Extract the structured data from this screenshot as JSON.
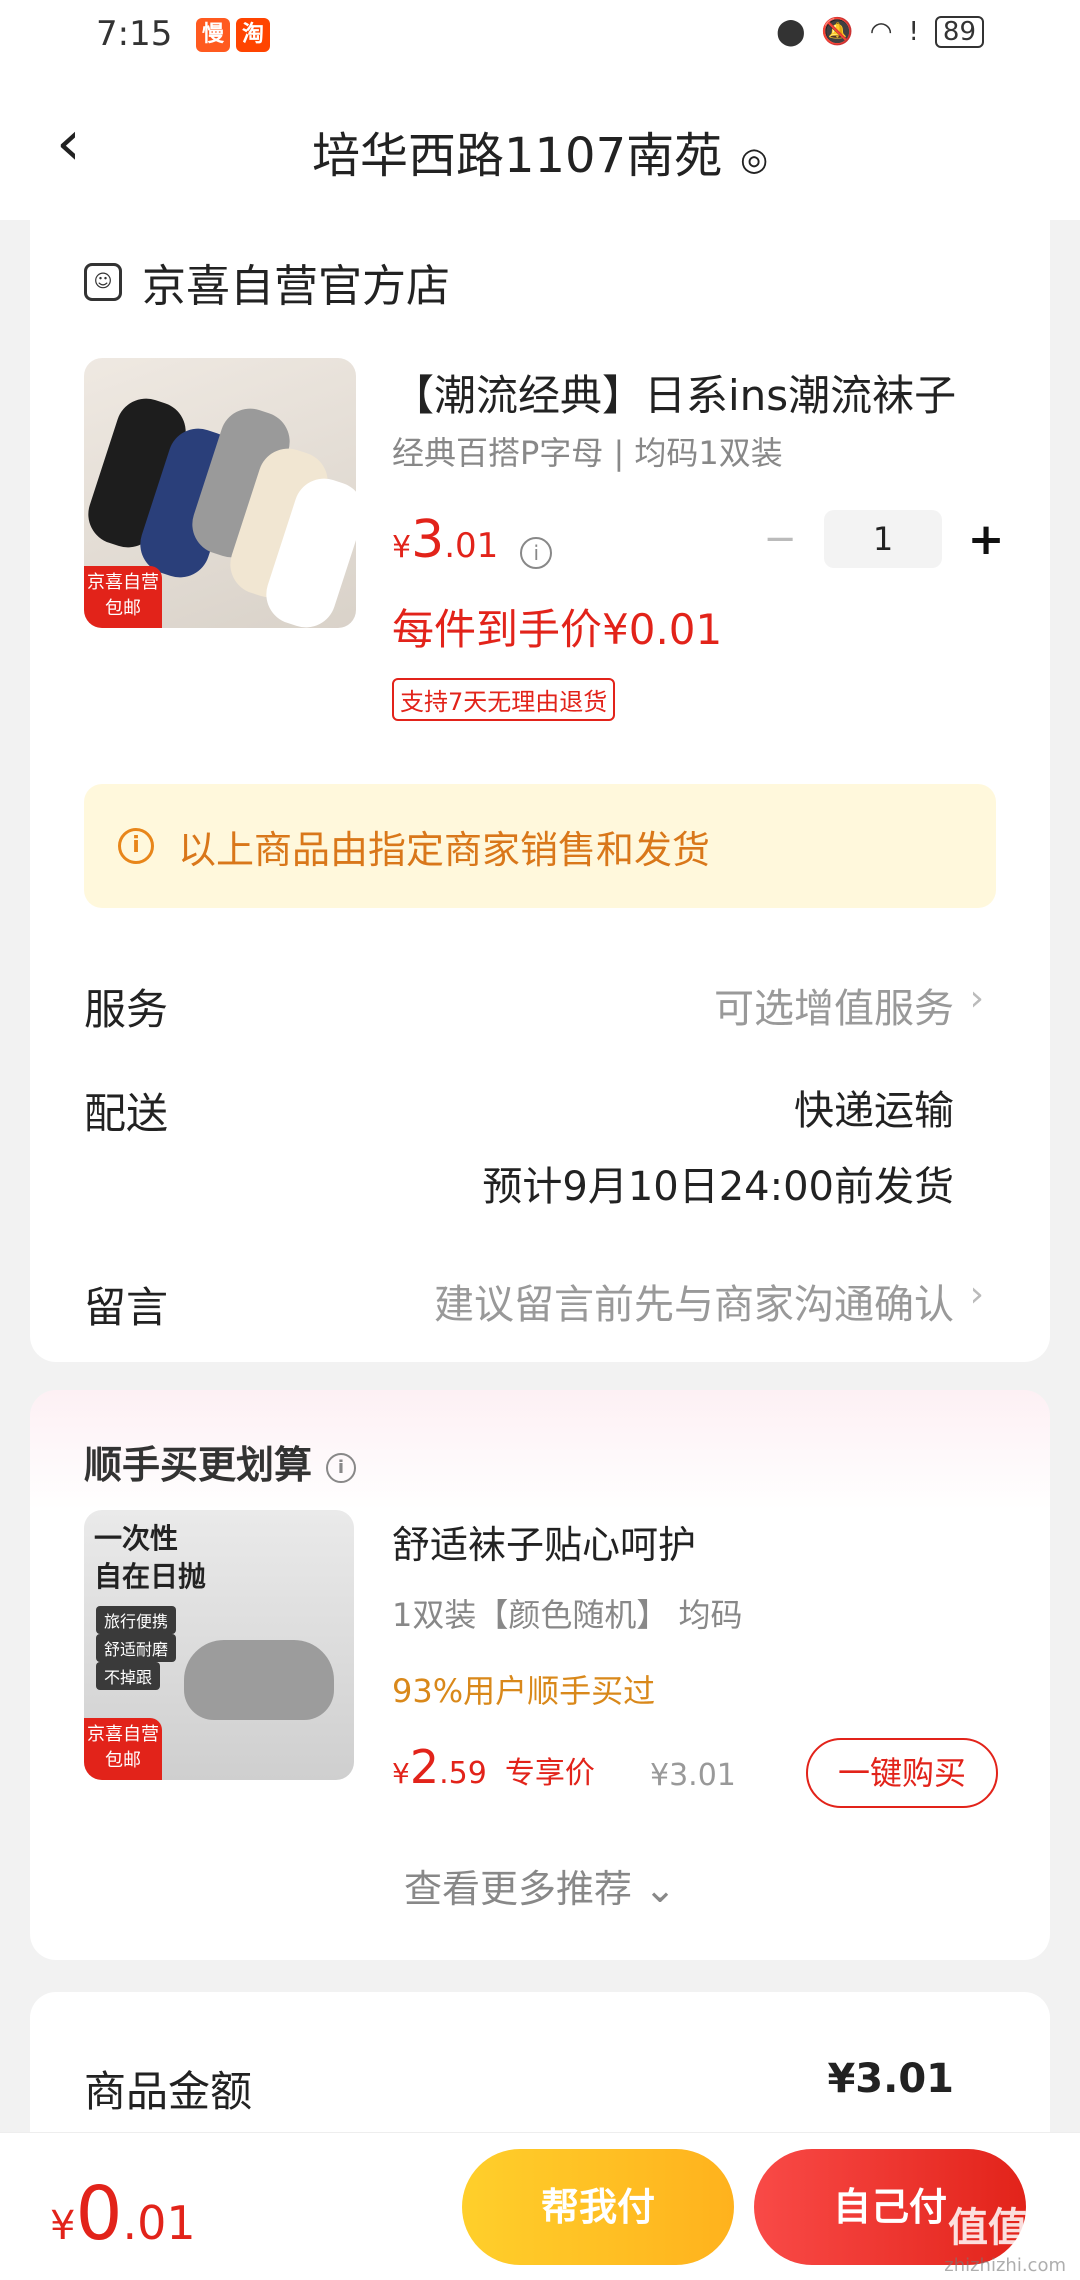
{
  "status_bar": {
    "time": "7:15",
    "app_badges": [
      "慢",
      "淘"
    ],
    "battery": "89"
  },
  "header": {
    "title": "培华西路1107南苑"
  },
  "store": {
    "name": "京喜自营官方店"
  },
  "product": {
    "title": "【潮流经典】日系ins潮流袜子",
    "spec": "经典百搭P字母 | 均码1双装",
    "price_yen": "¥",
    "price_int": "3",
    "price_dec": ".01",
    "quantity": "1",
    "final_price": "每件到手价¥0.01",
    "return_tag": "支持7天无理由退货",
    "image_tag_line1": "京喜自营",
    "image_tag_line2": "包邮"
  },
  "notice": {
    "text": "以上商品由指定商家销售和发货"
  },
  "rows": {
    "service_label": "服务",
    "service_value": "可选增值服务",
    "delivery_label": "配送",
    "delivery_value": "快递运输",
    "delivery_eta": "预计9月10日24:00前发货",
    "message_label": "留言",
    "message_placeholder": "建议留言前先与商家沟通确认"
  },
  "recommend": {
    "section_title": "顺手买更划算",
    "image_title_line1": "一次性",
    "image_title_line2": "自在日抛",
    "image_pills": [
      "旅行便携",
      "舒适耐磨",
      "不掉跟"
    ],
    "image_tag_line1": "京喜自营",
    "image_tag_line2": "包邮",
    "title": "舒适袜子贴心呵护",
    "spec": "1双装【颜色随机】   均码",
    "bought": "93%用户顺手买过",
    "price_yen": "¥",
    "price_int": "2",
    "price_dec": ".59",
    "exclusive_label": "专享价",
    "original_price": "¥3.01",
    "buy_button": "一键购买",
    "more_link": "查看更多推荐"
  },
  "summary": {
    "amount_label": "商品金额",
    "amount_value": "¥3.01"
  },
  "bottom_bar": {
    "total_yen": "¥",
    "total_int": "0",
    "total_dec": ".01",
    "help_pay": "帮我付",
    "self_pay": "自己付",
    "watermark": "值值值",
    "watermark_url": "zhizhizhi.com"
  },
  "colors": {
    "accent_red": "#e2231a",
    "notice_bg": "#fff8dc",
    "notice_text": "#d9771a",
    "help_button": "#ffb21d"
  }
}
